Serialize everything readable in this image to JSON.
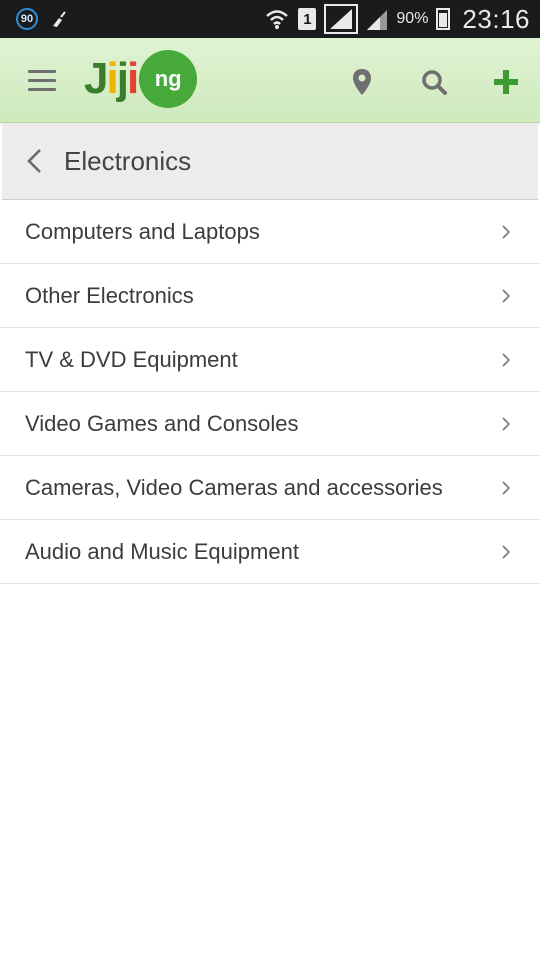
{
  "status_bar": {
    "notification_badge": "90",
    "sim_slot": "1",
    "battery_percent": "90%",
    "time": "23:16"
  },
  "app_bar": {
    "logo_text": "Jiji",
    "logo_badge": "ng",
    "icons": [
      "menu-icon",
      "location-pin-icon",
      "search-icon",
      "add-icon"
    ],
    "colors": {
      "brand_green": "#47a93a",
      "bar_bg": "#d6eec8",
      "logo_j": "#3a7d2c",
      "logo_dot": "#f2b300"
    }
  },
  "sub_header": {
    "title": "Electronics"
  },
  "categories": [
    {
      "label": "Computers and Laptops"
    },
    {
      "label": "Other Electronics"
    },
    {
      "label": "TV & DVD Equipment"
    },
    {
      "label": "Video Games and Consoles"
    },
    {
      "label": "Cameras, Video Cameras and accessories"
    },
    {
      "label": "Audio and Music Equipment"
    }
  ]
}
